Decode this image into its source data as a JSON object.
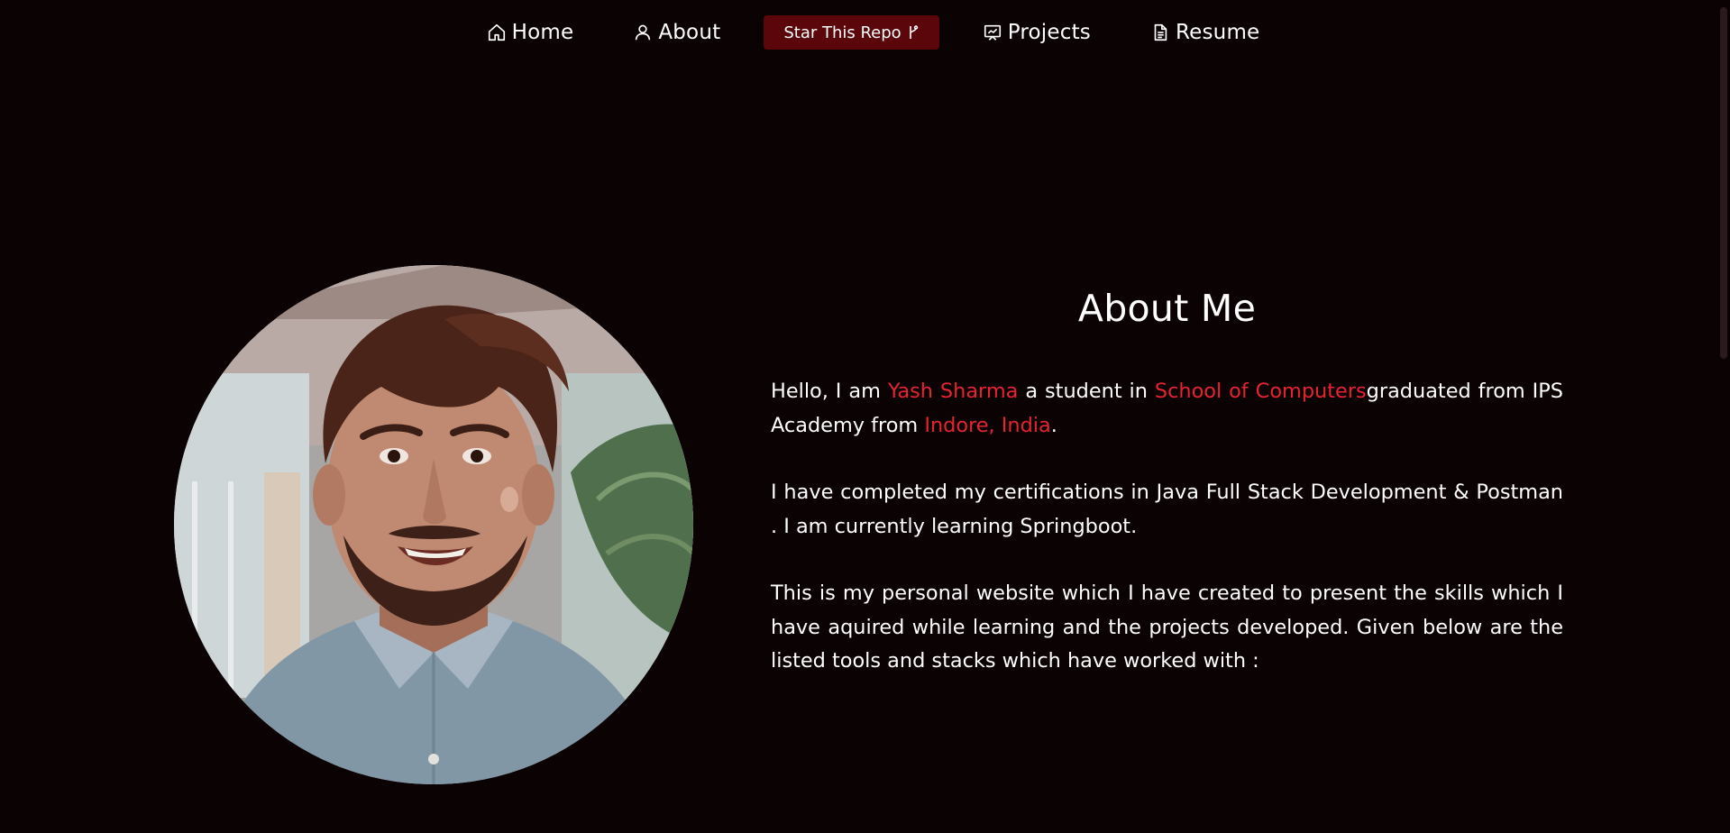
{
  "nav": {
    "home": "Home",
    "about": "About",
    "star": "Star This Repo",
    "projects": "Projects",
    "resume": "Resume"
  },
  "about": {
    "title": "About Me",
    "p1_a": "Hello, I am ",
    "name": "Yash Sharma",
    "p1_b": " a student in ",
    "school": "School of Computers",
    "p1_c": "graduated from IPS Academy from ",
    "location": "Indore, India",
    "p1_d": ".",
    "p2": "I have completed my certifications in Java Full Stack Development & Postman . I am currently learning Springboot.",
    "p3": "This is my personal website which I have created to present the skills which I have aquired while learning and the projects developed. Given below are the listed tools and stacks which have worked with :"
  },
  "colors": {
    "background": "#0b0204",
    "accent": "#e5242f",
    "star_button": "#5a060a"
  },
  "icons": {
    "home": "home-icon",
    "about": "user-icon",
    "star": "fork-icon",
    "projects": "presentation-icon",
    "resume": "document-icon"
  }
}
